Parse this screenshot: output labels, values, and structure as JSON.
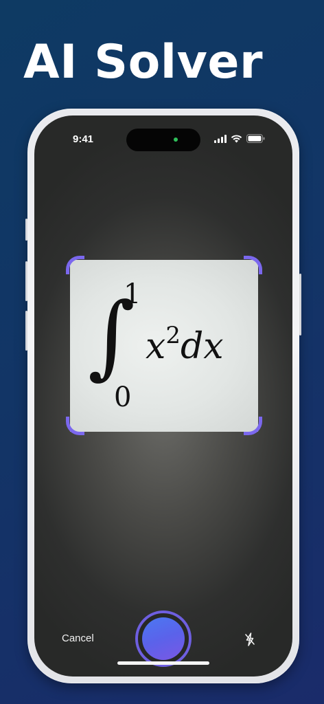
{
  "headline": "AI Solver",
  "status_bar": {
    "time": "9:41",
    "icons": [
      "cellular-signal-icon",
      "wifi-icon",
      "battery-icon"
    ]
  },
  "scan": {
    "formula": {
      "integral_symbol": "∫",
      "upper_limit": "1",
      "lower_limit": "0",
      "base": "x",
      "exponent": "2",
      "differential": "dx"
    },
    "frame_color": "#7b68ee"
  },
  "controls": {
    "cancel_label": "Cancel",
    "shutter_icon": "capture-icon",
    "flash_icon": "flash-off-icon"
  },
  "colors": {
    "background_top": "#0e3a63",
    "background_bottom": "#1a2b6a",
    "shutter_gradient_start": "#4b78f2",
    "shutter_gradient_end": "#7a58e4"
  }
}
